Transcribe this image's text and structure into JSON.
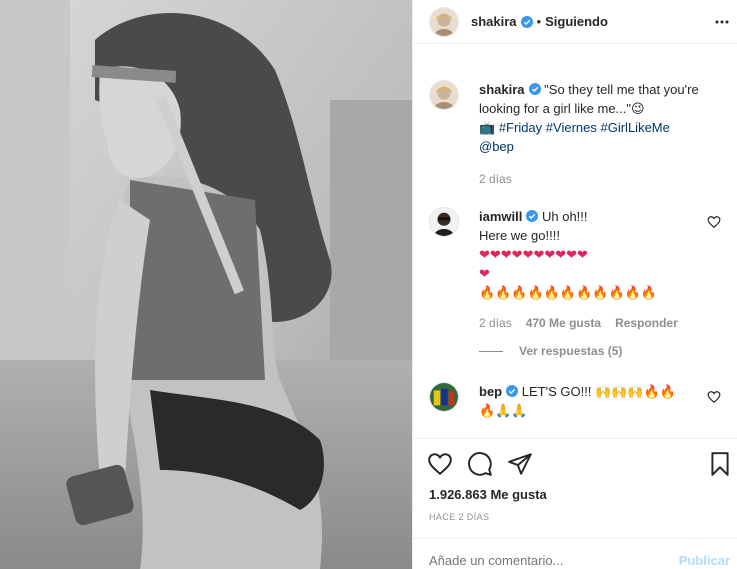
{
  "post": {
    "author": "shakira",
    "follow_separator": "•",
    "follow_label": "Siguiendo",
    "caption_author": "shakira",
    "caption_text": "\"So they tell me that you're looking for a girl like me...\"😉",
    "caption_tv": "📺",
    "hashtags": [
      "#Friday",
      "#Viernes",
      "#GirlLikeMe"
    ],
    "mention": "@bep",
    "caption_time": "2 días"
  },
  "comments": [
    {
      "user": "iamwill",
      "line1": "Uh oh!!!",
      "line2": "Here we go!!!!",
      "emoji_hearts": "❤❤❤❤❤❤❤❤❤❤",
      "emoji_heart_wrap": "❤",
      "emoji_fire": "🔥🔥🔥🔥🔥🔥🔥🔥🔥🔥🔥",
      "time": "2 días",
      "likes": "470 Me gusta",
      "reply": "Responder"
    },
    {
      "user": "bep",
      "line1": "LET'S GO!!! 🙌🙌🙌🔥🔥",
      "line2": "🔥🙏🙏"
    }
  ],
  "view_replies": "Ver respuestas (5)",
  "likes_count": "1.926.863 Me gusta",
  "posted_ago": "HACE 2 DÍAS",
  "comment_placeholder": "Añade un comentario...",
  "publish_label": "Publicar",
  "colors": {
    "verified": "#3897f0",
    "link": "#00376b",
    "muted": "#8e8e8e",
    "publish_disabled": "#b3dbff"
  }
}
